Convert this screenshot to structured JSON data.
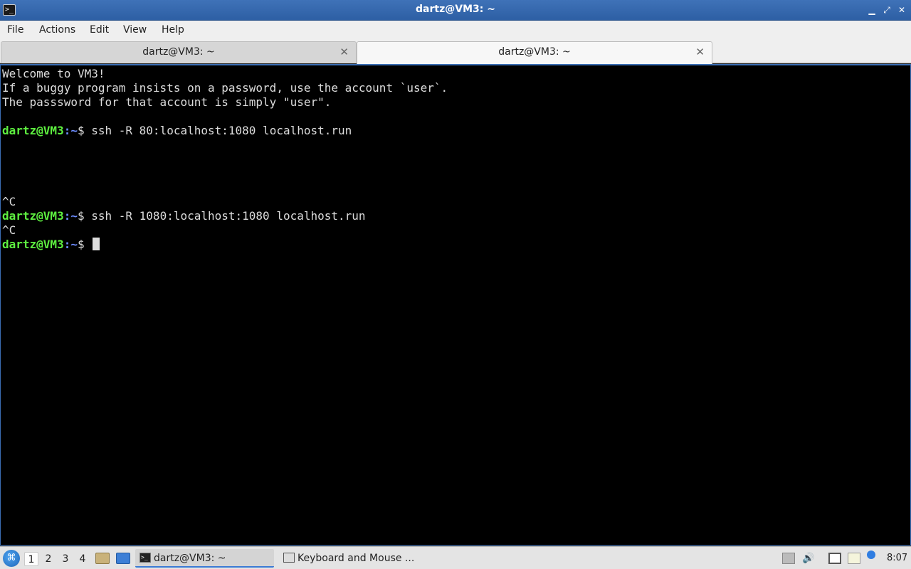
{
  "window": {
    "title": "dartz@VM3: ~",
    "minimize_glyph": "▁",
    "maximize_glyph": "⤢",
    "close_glyph": "✕"
  },
  "menu": [
    "File",
    "Actions",
    "Edit",
    "View",
    "Help"
  ],
  "tabs": [
    {
      "label": "dartz@VM3: ~",
      "active": false
    },
    {
      "label": "dartz@VM3: ~",
      "active": true
    }
  ],
  "tab_close_glyph": "✕",
  "terminal": {
    "lines": [
      "Welcome to VM3!",
      "If a buggy program insists on a password, use the account `user`.",
      "The passsword for that account is simply \"user\".",
      "",
      {
        "user": "dartz@VM3",
        "path": ":~",
        "cmd": "$ ssh -R 80:localhost:1080 localhost.run"
      },
      "",
      "",
      "",
      "",
      "^C",
      {
        "user": "dartz@VM3",
        "path": ":~",
        "cmd": "$ ssh -R 1080:localhost:1080 localhost.run"
      },
      "^C",
      {
        "user": "dartz@VM3",
        "path": ":~",
        "cmd": "$ ",
        "cursor": true
      }
    ]
  },
  "taskbar": {
    "workspaces": [
      "1",
      "2",
      "3",
      "4"
    ],
    "active_workspace": "1",
    "tasks": [
      {
        "label": "dartz@VM3: ~",
        "icon": "terminal-icon"
      },
      {
        "label": "Keyboard and Mouse ...",
        "icon": "keyboard-icon"
      }
    ],
    "clock": "8:07"
  }
}
